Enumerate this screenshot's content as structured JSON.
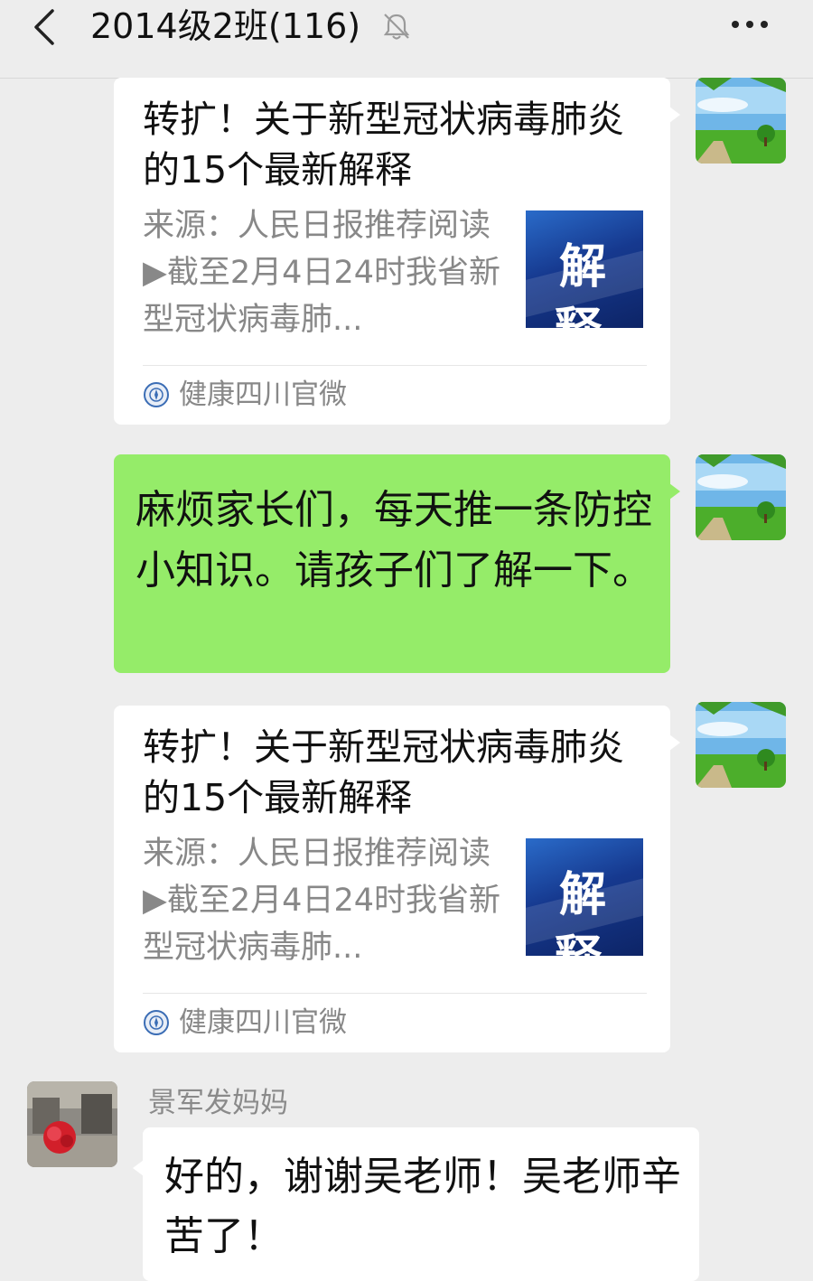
{
  "header": {
    "title": "2014级2班(116)",
    "back_icon": "chevron-left-icon",
    "mute_icon": "bell-slash-icon",
    "more_icon": "more-dots-icon"
  },
  "messages": [
    {
      "type": "link_card",
      "title": "转扩！关于新型冠状病毒肺炎的15个最新解释",
      "description": "来源：人民日报推荐阅读▶截至2月4日24时我省新型冠状病毒肺...",
      "thumbnail_text": "解 释",
      "source": "健康四川官微"
    },
    {
      "type": "text",
      "text": "麻烦家长们，每天推一条防控小知识。请孩子们了解一下。"
    },
    {
      "type": "link_card",
      "title": "转扩！关于新型冠状病毒肺炎的15个最新解释",
      "description": "来源：人民日报推荐阅读▶截至2月4日24时我省新型冠状病毒肺...",
      "thumbnail_text": "解 释",
      "source": "健康四川官微"
    },
    {
      "type": "text",
      "sender": "景军发妈妈",
      "text": "好的，谢谢吴老师！吴老师辛苦了！"
    }
  ],
  "colors": {
    "background": "#ededed",
    "sent_bubble": "#95ec69",
    "received_bubble": "#ffffff",
    "secondary_text": "#888888"
  }
}
